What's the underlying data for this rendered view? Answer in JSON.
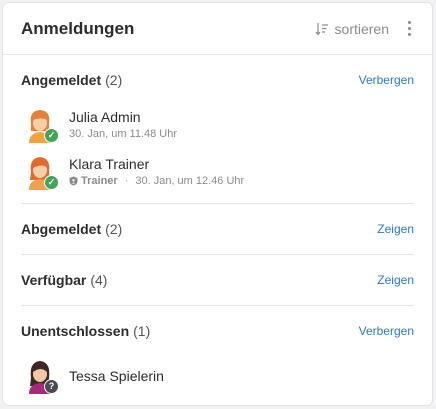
{
  "header": {
    "title": "Anmeldungen",
    "sort_label": "sortieren"
  },
  "sections": [
    {
      "title": "Angemeldet",
      "count": "(2)",
      "action": "Verbergen",
      "users": [
        {
          "name": "Julia Admin",
          "date": "30. Jan, um 11.48 Uhr",
          "role": "",
          "status": "confirmed"
        },
        {
          "name": "Klara Trainer",
          "date": "30. Jan, um 12.46 Uhr",
          "role": "Trainer",
          "status": "confirmed"
        }
      ]
    },
    {
      "title": "Abgemeldet",
      "count": "(2)",
      "action": "Zeigen"
    },
    {
      "title": "Verfügbar",
      "count": "(4)",
      "action": "Zeigen"
    },
    {
      "title": "Unentschlossen",
      "count": "(1)",
      "action": "Verbergen",
      "users": [
        {
          "name": "Tessa Spielerin",
          "status": "unknown"
        }
      ]
    }
  ],
  "icons": {
    "sort": "sort-descending-icon",
    "more": "more-vertical-icon",
    "confirmed": "check-icon",
    "unknown": "question-icon",
    "role": "shield-icon"
  },
  "colors": {
    "link": "#2a7ac0",
    "confirmed": "#3fa55b",
    "unknown": "#4a4a52",
    "hair_orange": "#e8803a",
    "hair_dark": "#3a2a25"
  }
}
